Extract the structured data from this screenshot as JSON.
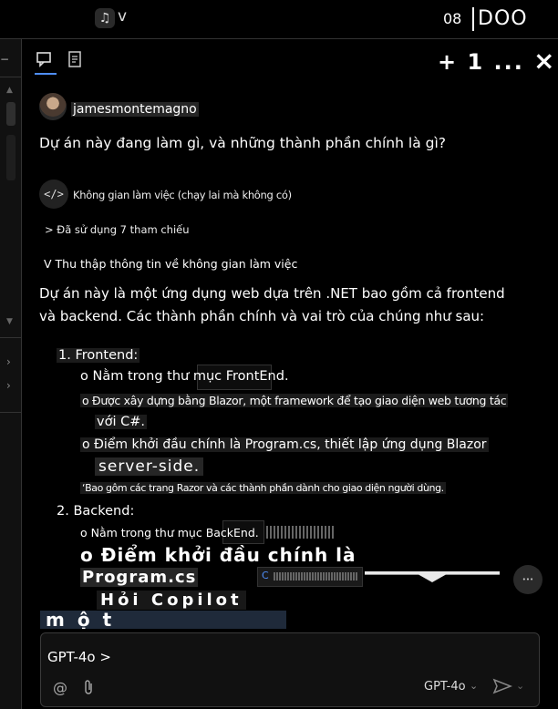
{
  "topbar": {
    "menu_label": "v",
    "number": "08",
    "box_text": "DOO"
  },
  "panel": {
    "actions": "+ 1 ...",
    "close": "×"
  },
  "chat": {
    "user": "jamesmontemagno",
    "question": "Dự án này đang làm gì, và những thành phần chính là gì?",
    "workspace_label": "Không gian làm việc (chạy lai mà không có)",
    "refs": "> Đã sử dụng 7 tham chiếu",
    "collect": "V Thu thập thông tin về không gian làm việc",
    "intro_line1": "Dự án này là một ứng dụng web dựa trên .NET bao gồm cả frontend",
    "intro_line2": "và backend. Các thành phần chính và vai trò của chúng như sau:",
    "fe_title": "1. Frontend:",
    "fe_1": "o Nằm trong thư mục FrontEnd.",
    "fe_2a": "o Được xây dựng bằng Blazor, một framework để tạo giao diện web tương tác",
    "fe_2b": "với C#.",
    "fe_3a": "o Điểm khởi đầu chính là Program.cs, thiết lập ứng dụng Blazor",
    "fe_3b": "server-side.",
    "fe_4": "‘Bao gôm các trang Razor và các thành phần dành cho giao diện người dùng.",
    "be_title": "2. Backend:",
    "be_1": "o Nằm trong thư mục BackEnd.",
    "be_2": "o Điểm khởi đầu chính là",
    "be_3": "Program.cs",
    "ghost_1": "Hỏi Copilot",
    "ghost_2": "một"
  },
  "input": {
    "model_chip": "GPT-4o >",
    "model_select": "GPT-4o"
  },
  "icons": [
    "copilot-icon",
    "chat-icon",
    "notes-icon",
    "code-icon",
    "mention-icon",
    "attach-icon",
    "send-icon",
    "chevron-down-icon",
    "close-icon"
  ]
}
